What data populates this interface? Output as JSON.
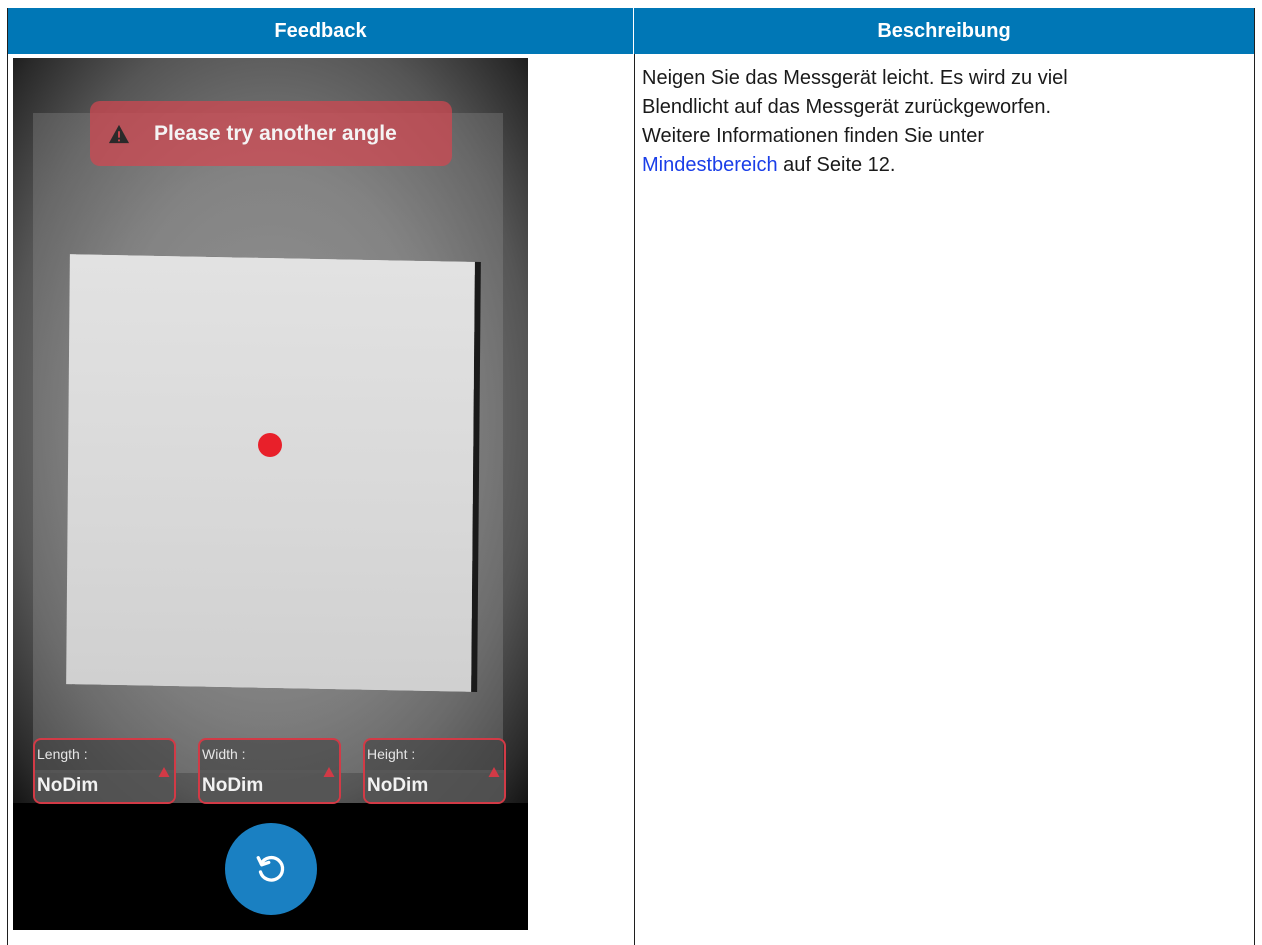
{
  "header": {
    "feedback": "Feedback",
    "description": "Beschreibung"
  },
  "phone": {
    "warning_banner": "Please try another angle",
    "dimensions": [
      {
        "label": "Length :",
        "value": "NoDim"
      },
      {
        "label": "Width :",
        "value": "NoDim"
      },
      {
        "label": "Height :",
        "value": "NoDim"
      }
    ],
    "icons": {
      "warning": "warning-triangle-icon",
      "refresh": "refresh-icon"
    },
    "colors": {
      "banner": "#d24650",
      "dot": "#e8202a",
      "button": "#1a80c2"
    }
  },
  "description": {
    "line1": "Neigen Sie das Messgerät leicht. Es wird zu viel",
    "line2": "Blendlicht auf das Messgerät zurückgeworfen.",
    "line3": "Weitere Informationen finden Sie unter",
    "link": "Mindestbereich",
    "link_suffix": " auf Seite 12."
  },
  "colors": {
    "header_bg": "#0077b6",
    "link": "#1a3ee8"
  }
}
